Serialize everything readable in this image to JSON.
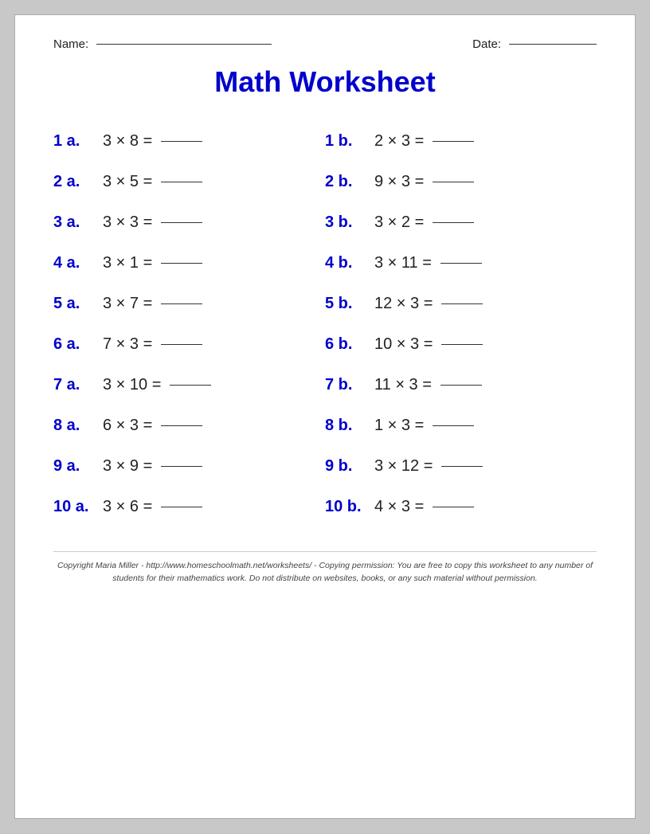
{
  "header": {
    "name_label": "Name:",
    "date_label": "Date:"
  },
  "title": "Math Worksheet",
  "problems": [
    {
      "id": "1 a.",
      "expr": "3 × 8 ="
    },
    {
      "id": "1 b.",
      "expr": "2 × 3 ="
    },
    {
      "id": "2 a.",
      "expr": "3 × 5 ="
    },
    {
      "id": "2 b.",
      "expr": "9 × 3 ="
    },
    {
      "id": "3 a.",
      "expr": "3 × 3 ="
    },
    {
      "id": "3 b.",
      "expr": "3 × 2 ="
    },
    {
      "id": "4 a.",
      "expr": "3 × 1 ="
    },
    {
      "id": "4 b.",
      "expr": "3 × 11 ="
    },
    {
      "id": "5 a.",
      "expr": "3 × 7 ="
    },
    {
      "id": "5 b.",
      "expr": "12 × 3 ="
    },
    {
      "id": "6 a.",
      "expr": "7 × 3 ="
    },
    {
      "id": "6 b.",
      "expr": "10 × 3 ="
    },
    {
      "id": "7 a.",
      "expr": "3 × 10 ="
    },
    {
      "id": "7 b.",
      "expr": "11 × 3 ="
    },
    {
      "id": "8 a.",
      "expr": "6 × 3 ="
    },
    {
      "id": "8 b.",
      "expr": "1 × 3 ="
    },
    {
      "id": "9 a.",
      "expr": "3 × 9 ="
    },
    {
      "id": "9 b.",
      "expr": "3 × 12 ="
    },
    {
      "id": "10 a.",
      "expr": "3 × 6 ="
    },
    {
      "id": "10 b.",
      "expr": "4 × 3 ="
    }
  ],
  "copyright": "Copyright Maria Miller - http://www.homeschoolmath.net/worksheets/ - Copying permission: You are free to copy this worksheet to any number of students for their mathematics work. Do not distribute on websites, books, or any such material without permission."
}
